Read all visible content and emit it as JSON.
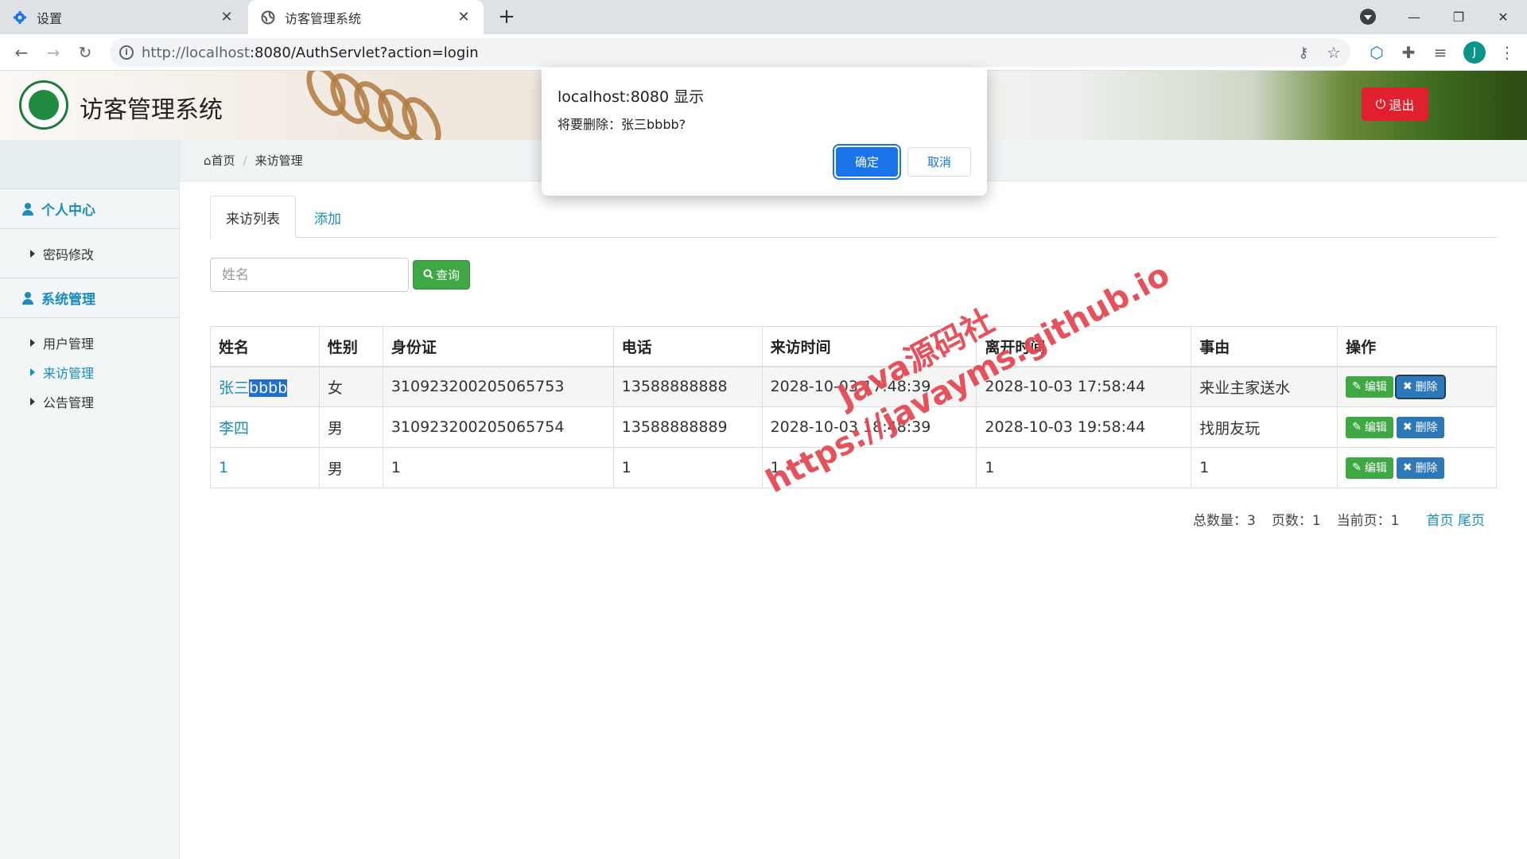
{
  "browser": {
    "tabs": [
      {
        "title": "设置",
        "icon": "gear-icon"
      },
      {
        "title": "访客管理系统",
        "icon": "globe-icon"
      }
    ],
    "new_tab_label": "+",
    "url_host": "http://localhost",
    "url_rest": ":8080/AuthServlet?action=login",
    "avatar_letter": "J"
  },
  "header": {
    "title": "访客管理系统",
    "logout_label": "退出"
  },
  "sidebar": {
    "groups": [
      {
        "label": "个人中心",
        "items": [
          {
            "label": "密码修改"
          }
        ]
      },
      {
        "label": "系统管理",
        "items": [
          {
            "label": "用户管理"
          },
          {
            "label": "来访管理"
          },
          {
            "label": "公告管理"
          }
        ]
      }
    ]
  },
  "breadcrumb": {
    "home": "首页",
    "current": "来访管理"
  },
  "content": {
    "tabs": [
      {
        "label": "来访列表"
      },
      {
        "label": "添加"
      }
    ],
    "search": {
      "placeholder": "姓名",
      "button_label": "查询"
    },
    "table": {
      "headers": [
        "姓名",
        "性别",
        "身份证",
        "电话",
        "来访时间",
        "离开时间",
        "事由",
        "操作"
      ],
      "rows": [
        {
          "name_a": "张三",
          "name_b": "bbbb",
          "gender": "女",
          "id_card": "310923200205065753",
          "phone": "13588888888",
          "visit_time": "2028-10-03 17:48:39",
          "leave_time": "2028-10-03 17:58:44",
          "reason": "来业主家送水"
        },
        {
          "name_a": "李四",
          "name_b": "",
          "gender": "男",
          "id_card": "310923200205065754",
          "phone": "13588888889",
          "visit_time": "2028-10-03 18:48:39",
          "leave_time": "2028-10-03 19:58:44",
          "reason": "找朋友玩"
        },
        {
          "name_a": "1",
          "name_b": "",
          "gender": "男",
          "id_card": "1",
          "phone": "1",
          "visit_time": "1",
          "leave_time": "1",
          "reason": "1"
        }
      ],
      "edit_label": "编辑",
      "delete_label": "删除"
    },
    "pager": {
      "total": "总数量：3",
      "pages": "页数：1",
      "current": "当前页：1",
      "first": "首页",
      "last": "尾页"
    }
  },
  "watermark": {
    "line1": "Java源码社",
    "line2": "https://javayms.github.io"
  },
  "dialog": {
    "title": "localhost:8080 显示",
    "message": "将要删除：张三bbbb?",
    "ok_label": "确定",
    "cancel_label": "取消"
  },
  "colors": {
    "accent": "#1a8cba",
    "danger": "#e0202f",
    "success": "#3fa845",
    "primary": "#2f78b7"
  }
}
